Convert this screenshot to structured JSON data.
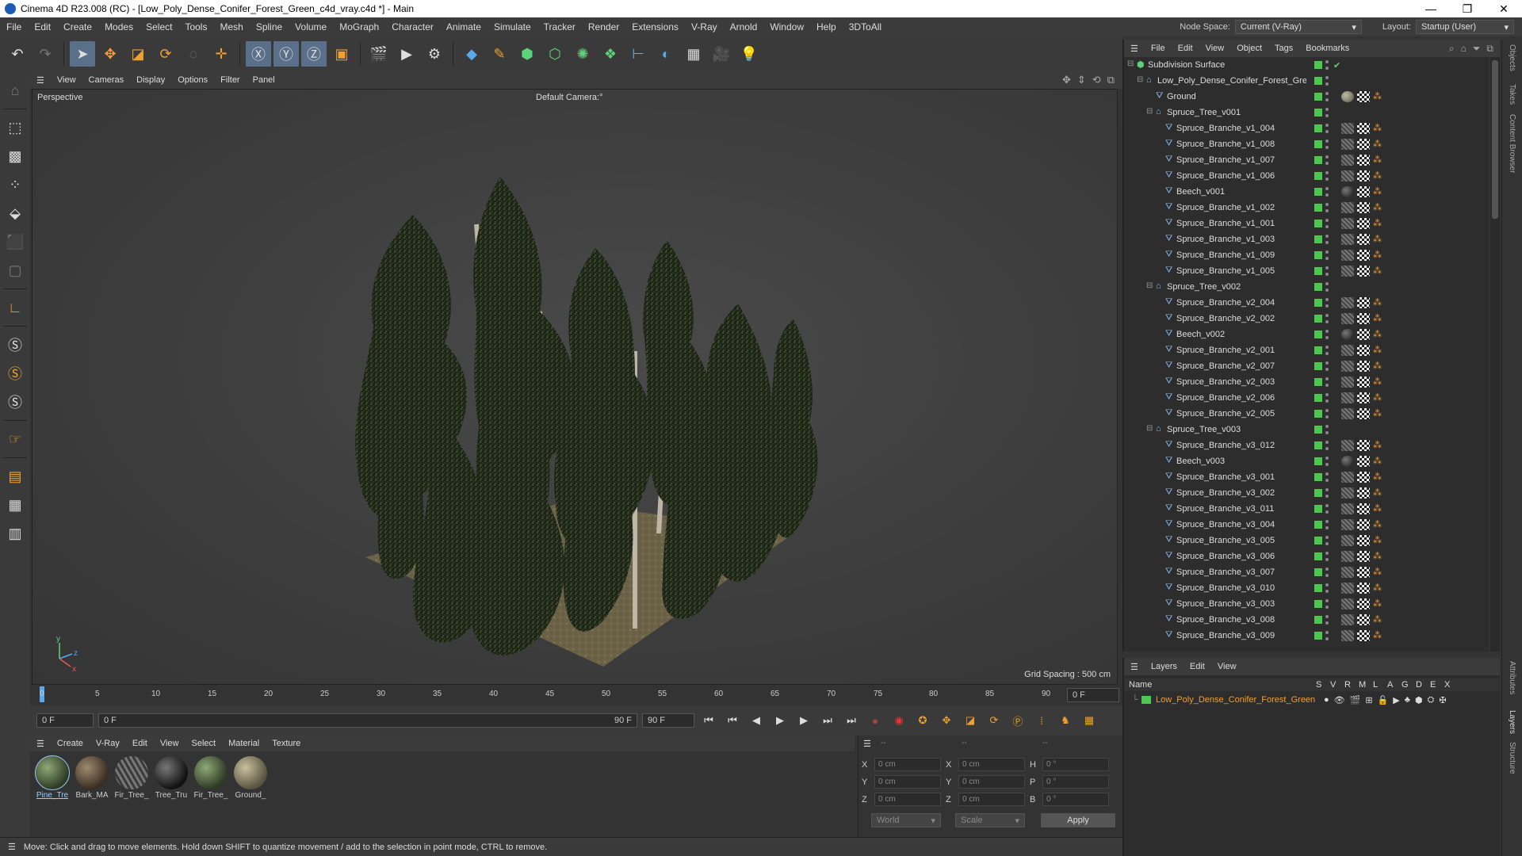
{
  "window": {
    "title": "Cinema 4D R23.008 (RC) - [Low_Poly_Dense_Conifer_Forest_Green_c4d_vray.c4d *] - Main",
    "controls": [
      "—",
      "❐",
      "✕"
    ]
  },
  "menubar": {
    "items": [
      "File",
      "Edit",
      "Create",
      "Modes",
      "Select",
      "Tools",
      "Mesh",
      "Spline",
      "Volume",
      "MoGraph",
      "Character",
      "Animate",
      "Simulate",
      "Tracker",
      "Render",
      "Extensions",
      "V-Ray",
      "Arnold",
      "Window",
      "Help",
      "3DToAll"
    ],
    "node_space_label": "Node Space:",
    "node_space_value": "Current (V-Ray)",
    "layout_label": "Layout:",
    "layout_value": "Startup (User)"
  },
  "viewport": {
    "menu": [
      "View",
      "Cameras",
      "Display",
      "Options",
      "Filter",
      "Panel"
    ],
    "label": "Perspective",
    "camera": "Default Camera",
    "camera_suffix": ":°",
    "grid_spacing": "Grid Spacing : 500 cm"
  },
  "timeline": {
    "ticks": [
      "0",
      "5",
      "10",
      "15",
      "20",
      "25",
      "30",
      "35",
      "40",
      "45",
      "50",
      "55",
      "60",
      "65",
      "70",
      "75",
      "80",
      "85",
      "90"
    ],
    "current_frame_right": "0 F",
    "start_field": "0 F",
    "range_start": "0 F",
    "range_end": "90 F",
    "end_field": "90 F"
  },
  "materials": {
    "menu": [
      "Create",
      "V-Ray",
      "Edit",
      "View",
      "Select",
      "Material",
      "Texture"
    ],
    "items": [
      {
        "name": "Pine_Tre",
        "type": "veg",
        "selected": true
      },
      {
        "name": "Bark_MA",
        "type": "bark",
        "selected": false
      },
      {
        "name": "Fir_Tree_",
        "type": "veg2",
        "selected": false
      },
      {
        "name": "Tree_Tru",
        "type": "dark",
        "selected": false
      },
      {
        "name": "Fir_Tree_",
        "type": "veg",
        "selected": false
      },
      {
        "name": "Ground_",
        "type": "ground",
        "selected": false
      }
    ]
  },
  "coords": {
    "header": [
      "--",
      "--",
      "--"
    ],
    "rows": [
      {
        "a": "X",
        "av": "0 cm",
        "b": "X",
        "bv": "0 cm",
        "c": "H",
        "cv": "0 °"
      },
      {
        "a": "Y",
        "av": "0 cm",
        "b": "Y",
        "bv": "0 cm",
        "c": "P",
        "cv": "0 °"
      },
      {
        "a": "Z",
        "av": "0 cm",
        "b": "Z",
        "bv": "0 cm",
        "c": "B",
        "cv": "0 °"
      }
    ],
    "space": "World",
    "mode": "Scale",
    "apply": "Apply"
  },
  "status": "Move: Click and drag to move elements. Hold down SHIFT to quantize movement / add to the selection in point mode, CTRL to remove.",
  "objects_panel": {
    "menu": [
      "File",
      "Edit",
      "View",
      "Object",
      "Tags",
      "Bookmarks"
    ],
    "items": [
      {
        "name": "Subdivision Surface",
        "level": 0,
        "kind": "subdiv"
      },
      {
        "name": "Low_Poly_Dense_Conifer_Forest_Green",
        "level": 1,
        "kind": "null"
      },
      {
        "name": "Ground",
        "level": 2,
        "kind": "mesh",
        "tag": "ground"
      },
      {
        "name": "Spruce_Tree_v001",
        "level": 2,
        "kind": "null"
      },
      {
        "name": "Spruce_Branche_v1_004",
        "level": 3,
        "kind": "mesh",
        "tag": "veg"
      },
      {
        "name": "Spruce_Branche_v1_008",
        "level": 3,
        "kind": "mesh",
        "tag": "veg"
      },
      {
        "name": "Spruce_Branche_v1_007",
        "level": 3,
        "kind": "mesh",
        "tag": "veg"
      },
      {
        "name": "Spruce_Branche_v1_006",
        "level": 3,
        "kind": "mesh",
        "tag": "veg"
      },
      {
        "name": "Beech_v001",
        "level": 3,
        "kind": "mesh",
        "tag": "sphere"
      },
      {
        "name": "Spruce_Branche_v1_002",
        "level": 3,
        "kind": "mesh",
        "tag": "veg"
      },
      {
        "name": "Spruce_Branche_v1_001",
        "level": 3,
        "kind": "mesh",
        "tag": "veg"
      },
      {
        "name": "Spruce_Branche_v1_003",
        "level": 3,
        "kind": "mesh",
        "tag": "veg"
      },
      {
        "name": "Spruce_Branche_v1_009",
        "level": 3,
        "kind": "mesh",
        "tag": "veg"
      },
      {
        "name": "Spruce_Branche_v1_005",
        "level": 3,
        "kind": "mesh",
        "tag": "veg"
      },
      {
        "name": "Spruce_Tree_v002",
        "level": 2,
        "kind": "null"
      },
      {
        "name": "Spruce_Branche_v2_004",
        "level": 3,
        "kind": "mesh",
        "tag": "veg"
      },
      {
        "name": "Spruce_Branche_v2_002",
        "level": 3,
        "kind": "mesh",
        "tag": "veg"
      },
      {
        "name": "Beech_v002",
        "level": 3,
        "kind": "mesh",
        "tag": "sphere"
      },
      {
        "name": "Spruce_Branche_v2_001",
        "level": 3,
        "kind": "mesh",
        "tag": "veg"
      },
      {
        "name": "Spruce_Branche_v2_007",
        "level": 3,
        "kind": "mesh",
        "tag": "veg"
      },
      {
        "name": "Spruce_Branche_v2_003",
        "level": 3,
        "kind": "mesh",
        "tag": "veg"
      },
      {
        "name": "Spruce_Branche_v2_006",
        "level": 3,
        "kind": "mesh",
        "tag": "veg"
      },
      {
        "name": "Spruce_Branche_v2_005",
        "level": 3,
        "kind": "mesh",
        "tag": "veg"
      },
      {
        "name": "Spruce_Tree_v003",
        "level": 2,
        "kind": "null"
      },
      {
        "name": "Spruce_Branche_v3_012",
        "level": 3,
        "kind": "mesh",
        "tag": "veg"
      },
      {
        "name": "Beech_v003",
        "level": 3,
        "kind": "mesh",
        "tag": "sphere"
      },
      {
        "name": "Spruce_Branche_v3_001",
        "level": 3,
        "kind": "mesh",
        "tag": "veg"
      },
      {
        "name": "Spruce_Branche_v3_002",
        "level": 3,
        "kind": "mesh",
        "tag": "veg"
      },
      {
        "name": "Spruce_Branche_v3_011",
        "level": 3,
        "kind": "mesh",
        "tag": "veg"
      },
      {
        "name": "Spruce_Branche_v3_004",
        "level": 3,
        "kind": "mesh",
        "tag": "veg"
      },
      {
        "name": "Spruce_Branche_v3_005",
        "level": 3,
        "kind": "mesh",
        "tag": "veg"
      },
      {
        "name": "Spruce_Branche_v3_006",
        "level": 3,
        "kind": "mesh",
        "tag": "veg"
      },
      {
        "name": "Spruce_Branche_v3_007",
        "level": 3,
        "kind": "mesh",
        "tag": "veg"
      },
      {
        "name": "Spruce_Branche_v3_010",
        "level": 3,
        "kind": "mesh",
        "tag": "veg"
      },
      {
        "name": "Spruce_Branche_v3_003",
        "level": 3,
        "kind": "mesh",
        "tag": "veg"
      },
      {
        "name": "Spruce_Branche_v3_008",
        "level": 3,
        "kind": "mesh",
        "tag": "veg"
      },
      {
        "name": "Spruce_Branche_v3_009",
        "level": 3,
        "kind": "mesh",
        "tag": "veg"
      }
    ]
  },
  "layers_panel": {
    "menu": [
      "Layers",
      "Edit",
      "View"
    ],
    "header_name": "Name",
    "header_cols": [
      "S",
      "V",
      "R",
      "M",
      "L",
      "A",
      "G",
      "D",
      "E",
      "X"
    ],
    "layer_name": "Low_Poly_Dense_Conifer_Forest_Green"
  },
  "right_tabs": [
    "Objects",
    "Takes",
    "Content Browser",
    "Attributes",
    "Layers",
    "Structure"
  ],
  "colors": {
    "accent": "#f0a030",
    "selection": "#5a6f8a",
    "layer_green": "#4fc552"
  }
}
